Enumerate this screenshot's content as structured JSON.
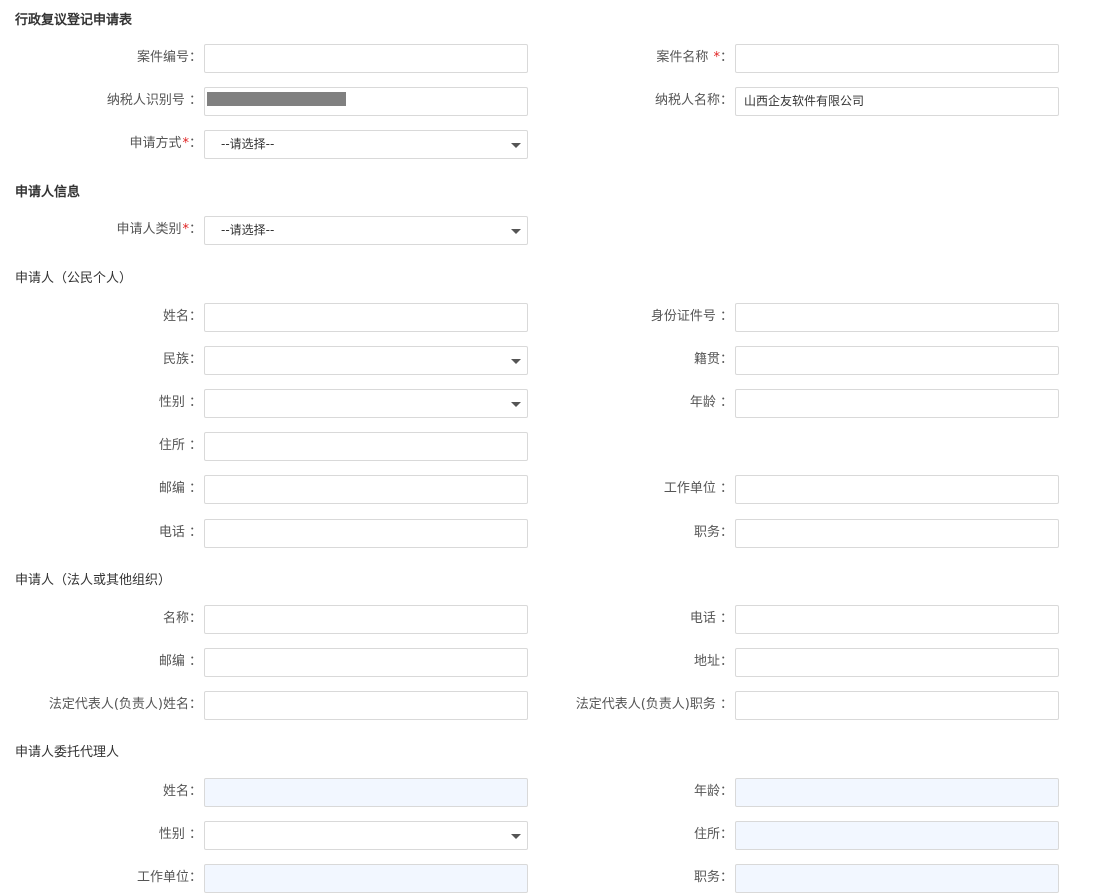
{
  "page_title": "行政复议登记申请表",
  "top": {
    "case_no_label": "案件编号：",
    "case_name_label": "案件名称",
    "taxpayer_id_label": "纳税人识别号 ：",
    "taxpayer_name_label": "纳税人名称：",
    "taxpayer_name_value": "山西企友软件有限公司",
    "apply_method_label": "申请方式",
    "apply_method_value": "--请选择--",
    "required_mark": "*",
    "colon": "："
  },
  "applicant_info": {
    "title": "申请人信息",
    "category_label": "申请人类别",
    "category_value": "--请选择--"
  },
  "citizen": {
    "title": "申请人（公民个人）",
    "name_label": "姓名：",
    "id_label": "身份证件号 ：",
    "ethnicity_label": "民族：",
    "native_label": "籍贯：",
    "gender_label": "性别 ：",
    "age_label": "年龄 ：",
    "address_label": "住所 ：",
    "postcode_label": "邮编 ：",
    "workplace_label": "工作单位 ：",
    "phone_label": "电话 ：",
    "position_label": "职务："
  },
  "org": {
    "title": "申请人（法人或其他组织）",
    "name_label": "名称：",
    "phone_label": "电话 ：",
    "postcode_label": "邮编 ：",
    "address_label": "地址：",
    "rep_name_label": "法定代表人(负责人)姓名：",
    "rep_position_label": "法定代表人(负责人)职务 ："
  },
  "agent": {
    "title": "申请人委托代理人",
    "name_label": "姓名：",
    "age_label": "年龄：",
    "gender_label": "性别 ：",
    "address_label": "住所：",
    "workplace_label": "工作单位：",
    "position_label": "职务："
  }
}
